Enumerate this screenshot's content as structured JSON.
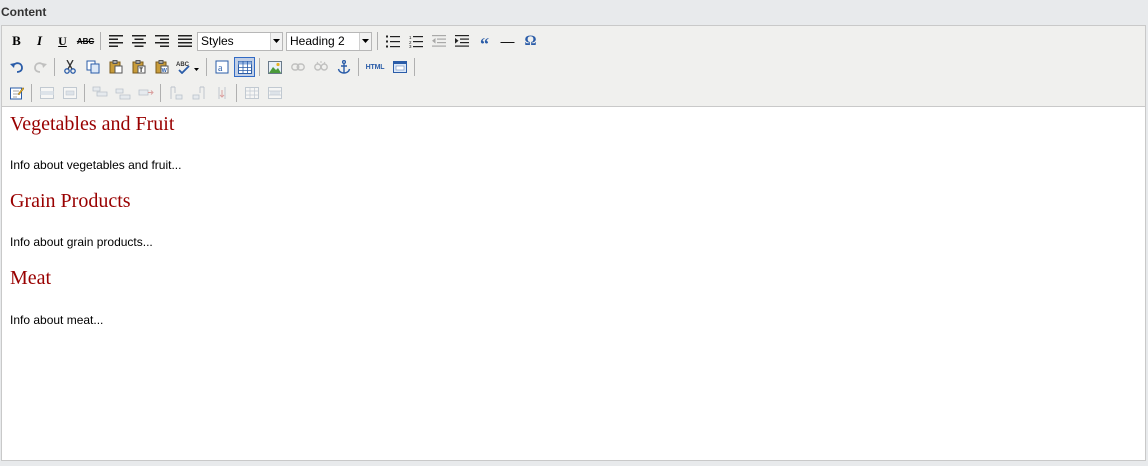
{
  "field_label": "Content",
  "toolbar": {
    "bold_label": "B",
    "italic_label": "I",
    "underline_label": "U",
    "strike_label": "ABC",
    "styles_select": "Styles",
    "format_select": "Heading 2",
    "blockquote_label": "“",
    "hr_label": "—",
    "charmap_label": "Ω",
    "html_label": "HTML",
    "icons": [
      "bold-icon",
      "italic-icon",
      "underline-icon",
      "strikethrough-icon",
      "align-left-icon",
      "align-center-icon",
      "align-right-icon",
      "align-justify-icon",
      "bullet-list-icon",
      "numbered-list-icon",
      "outdent-icon",
      "indent-icon",
      "blockquote-icon",
      "horizontal-rule-icon",
      "special-char-icon",
      "undo-icon",
      "redo-icon",
      "cut-icon",
      "copy-icon",
      "paste-icon",
      "paste-text-icon",
      "paste-word-icon",
      "spellcheck-icon",
      "find-icon",
      "table-icon",
      "image-icon",
      "link-icon",
      "unlink-icon",
      "anchor-icon",
      "html-source-icon",
      "preview-icon",
      "edit-icon",
      "insert-row-icon",
      "delete-row-icon",
      "table-cell-icon",
      "split-cell-icon",
      "merge-cell-icon"
    ]
  },
  "document": {
    "sections": [
      {
        "heading": "Vegetables and Fruit",
        "body": "Info about vegetables and fruit..."
      },
      {
        "heading": "Grain Products",
        "body": "Info about grain products..."
      },
      {
        "heading": "Meat",
        "body": "Info about meat..."
      }
    ]
  },
  "colors": {
    "heading": "#990000",
    "toolbar_bg": "#f0f0ee",
    "accent_blue": "#316ac5"
  }
}
